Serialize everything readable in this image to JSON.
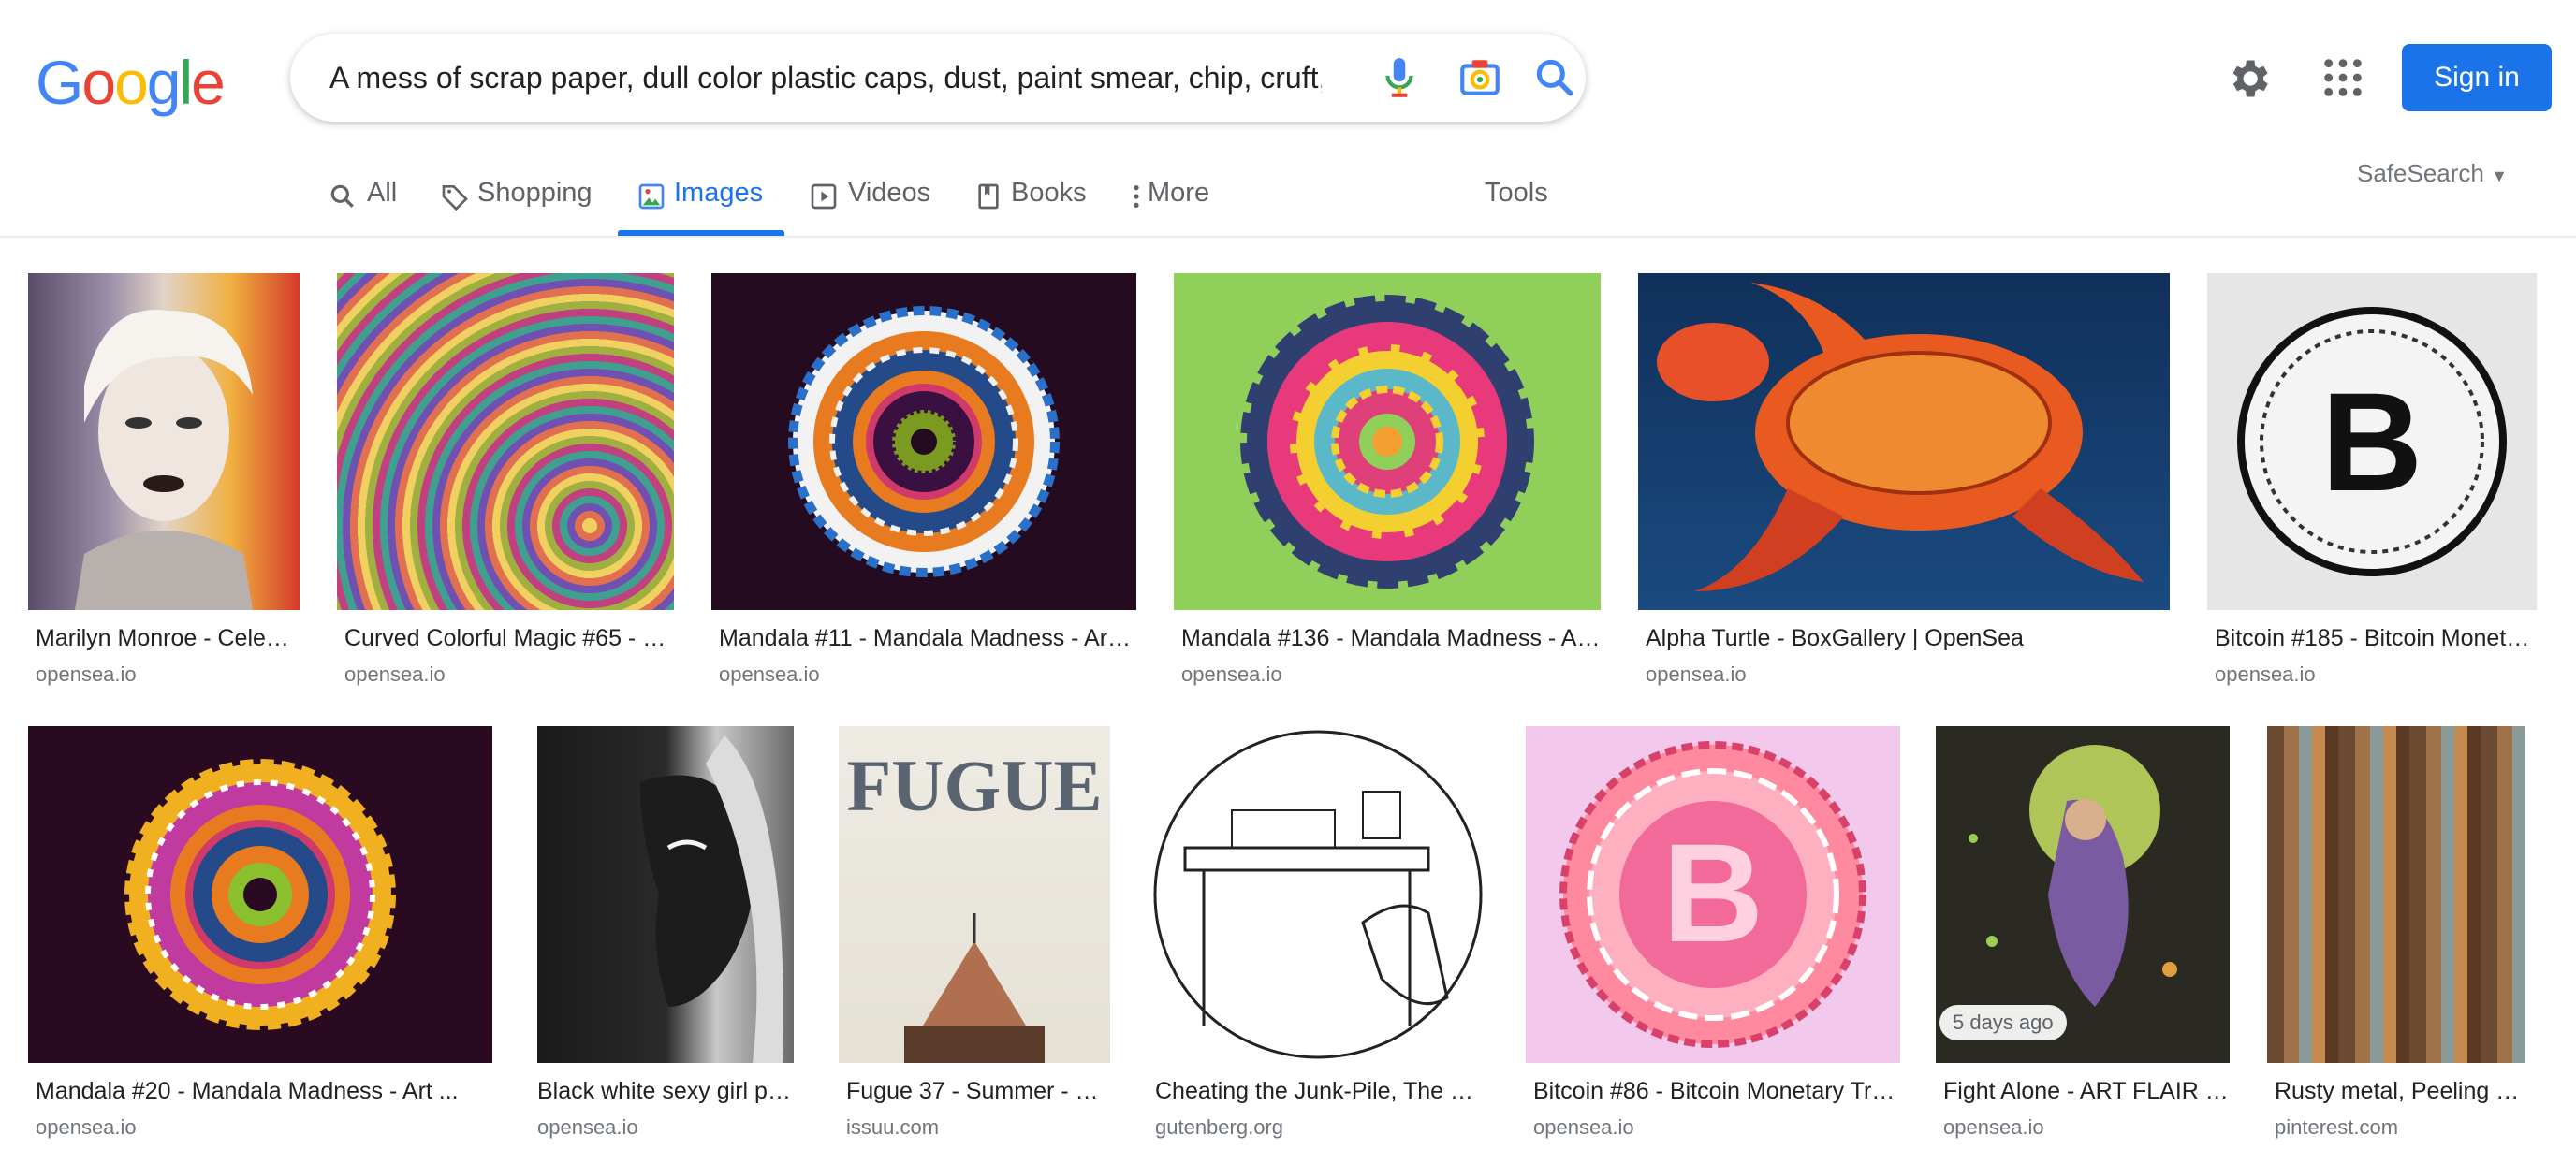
{
  "logo": {
    "letters": [
      "G",
      "o",
      "o",
      "g",
      "l",
      "e"
    ],
    "colors": [
      "#4285f4",
      "#ea4335",
      "#fbbc05",
      "#4285f4",
      "#34a853",
      "#ea4335"
    ]
  },
  "search": {
    "query": "A mess of scrap paper, dull color plastic caps, dust, paint smear, chip, cruft,"
  },
  "header": {
    "signin_label": "Sign in"
  },
  "tabs": [
    {
      "label": "All"
    },
    {
      "label": "Shopping"
    },
    {
      "label": "Images"
    },
    {
      "label": "Videos"
    },
    {
      "label": "Books"
    },
    {
      "label": "More"
    }
  ],
  "tools_label": "Tools",
  "safesearch_label": "SafeSearch",
  "results": [
    {
      "title": "Marilyn Monroe - Celeb…",
      "domain": "opensea.io"
    },
    {
      "title": "Curved Colorful Magic #65 - …",
      "domain": "opensea.io"
    },
    {
      "title": "Mandala #11 - Mandala Madness - Art…",
      "domain": "opensea.io"
    },
    {
      "title": "Mandala #136 - Mandala Madness - A…",
      "domain": "opensea.io"
    },
    {
      "title": "Alpha Turtle - BoxGallery | OpenSea",
      "domain": "opensea.io"
    },
    {
      "title": "Bitcoin #185 - Bitcoin Monet…",
      "domain": "opensea.io"
    },
    {
      "title": "Mandala #20 - Mandala Madness - Art ...",
      "domain": "opensea.io"
    },
    {
      "title": "Black white sexy girl pa…",
      "domain": "opensea.io"
    },
    {
      "title": "Fugue 37 - Summer - F…",
      "domain": "issuu.com",
      "image_text": "FUGUE"
    },
    {
      "title": "Cheating the Junk-Pile, The P…",
      "domain": "gutenberg.org"
    },
    {
      "title": "Bitcoin #86 - Bitcoin Monetary Tr…",
      "domain": "opensea.io"
    },
    {
      "title": "Fight Alone - ART FLAIR |…",
      "domain": "opensea.io",
      "badge": "5 days ago"
    },
    {
      "title": "Rusty metal, Peeling pa…",
      "domain": "pinterest.com"
    }
  ]
}
